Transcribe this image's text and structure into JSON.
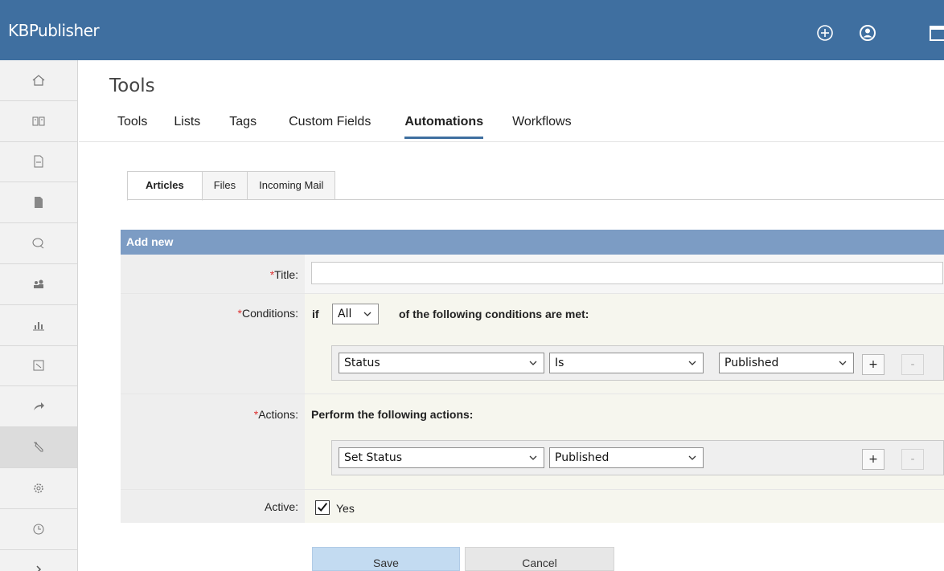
{
  "app": {
    "title": "KBPublisher"
  },
  "header_icons": [
    "plus-circle-icon",
    "user-circle-icon",
    "window-icon"
  ],
  "sidebar": {
    "items": [
      {
        "icon": "home-icon"
      },
      {
        "icon": "book-icon"
      },
      {
        "icon": "document-icon"
      },
      {
        "icon": "file-icon"
      },
      {
        "icon": "chat-icon"
      },
      {
        "icon": "users-icon"
      },
      {
        "icon": "chart-icon"
      },
      {
        "icon": "export-icon"
      },
      {
        "icon": "share-arrow-icon"
      },
      {
        "icon": "wrench-icon",
        "active": true
      },
      {
        "icon": "gear-icon"
      },
      {
        "icon": "clock-icon"
      },
      {
        "icon": "chevron-right-icon"
      }
    ]
  },
  "page": {
    "title": "Tools"
  },
  "main_tabs": [
    {
      "label": "Tools"
    },
    {
      "label": "Lists"
    },
    {
      "label": "Tags"
    },
    {
      "label": "Custom Fields"
    },
    {
      "label": "Automations",
      "active": true
    },
    {
      "label": "Workflows"
    }
  ],
  "sub_tabs": [
    {
      "label": "Articles",
      "active": true
    },
    {
      "label": "Files"
    },
    {
      "label": "Incoming Mail"
    }
  ],
  "form": {
    "header": "Add new",
    "required_mark": "*",
    "title_label": "Title:",
    "title_value": "",
    "conditions_label": "Conditions:",
    "cond_if": "if",
    "cond_match_value": "All",
    "cond_tail": "of the following conditions are met:",
    "condition": {
      "field": "Status",
      "operator": "Is",
      "value": "Published"
    },
    "actions_label": "Actions:",
    "actions_text": "Perform the following actions:",
    "action": {
      "type": "Set Status",
      "value": "Published"
    },
    "active_label": "Active:",
    "active_checked": true,
    "active_text": "Yes",
    "add_btn": "+",
    "remove_btn": "-"
  },
  "buttons": {
    "save": "Save",
    "cancel": "Cancel"
  },
  "colors": {
    "header_bg": "#3f6fa0",
    "form_head_bg": "#7c9cc4",
    "required": "#dd3333"
  }
}
